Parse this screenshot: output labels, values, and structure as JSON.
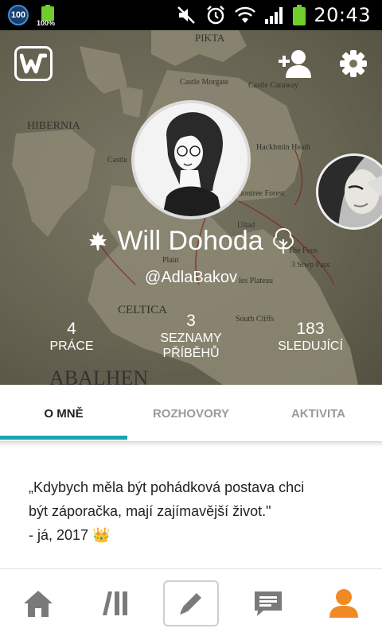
{
  "status_bar": {
    "notification_badge": "100",
    "battery_percent_label": "100%",
    "time": "20:43",
    "icons": [
      "notification-100-icon",
      "battery-small-icon",
      "mute-icon",
      "alarm-icon",
      "wifi-icon",
      "signal-icon",
      "battery-icon"
    ]
  },
  "profile": {
    "display_name": "Will Dohoda",
    "username": "@AdlaBakov",
    "name_left_icon": "maple-leaf-icon",
    "name_right_icon": "tree-icon"
  },
  "stats": [
    {
      "value": "4",
      "label_lines": [
        "PRÁCE"
      ]
    },
    {
      "value": "3",
      "label_lines": [
        "SEZNAMY",
        "PŘÍBĚHŮ"
      ]
    },
    {
      "value": "183",
      "label_lines": [
        "SLEDUJÍCÍ"
      ]
    }
  ],
  "tabs": [
    {
      "label": "O MNĚ",
      "active": true
    },
    {
      "label": "ROZHOVORY",
      "active": false
    },
    {
      "label": "AKTIVITA",
      "active": false
    }
  ],
  "about": {
    "line1": "„Kdybych měla být pohádková postava chci",
    "line2": "být záporačka, mají zajímavější život.\"",
    "line3": "- já, 2017 👑"
  },
  "map_labels": {
    "pikta": "PIKTA",
    "hibernia": "HIBERNIA",
    "celtica": "CELTICA",
    "abalhen": "ABALHEN",
    "castle_morgate": "Castle Morgate",
    "castle_caraway": "Castle Caraway",
    "hackhmin_heath": "Hackhmin Heath",
    "castle": "Castle",
    "dontree_forest": "dontree Forest",
    "plain": "Plain",
    "steep_pass": "3 Stwp Pass",
    "les_plateau": "les Plateau",
    "south_cliffs": "South Cliffs",
    "the_feus": "The Feus",
    "ultad": "Ultad"
  },
  "bottom_nav": [
    "home-icon",
    "library-icon",
    "write-icon",
    "messages-icon",
    "profile-icon"
  ],
  "colors": {
    "accent_teal": "#19a3b3",
    "profile_orange": "#f08a24",
    "nav_gray": "#7a7a7a"
  }
}
